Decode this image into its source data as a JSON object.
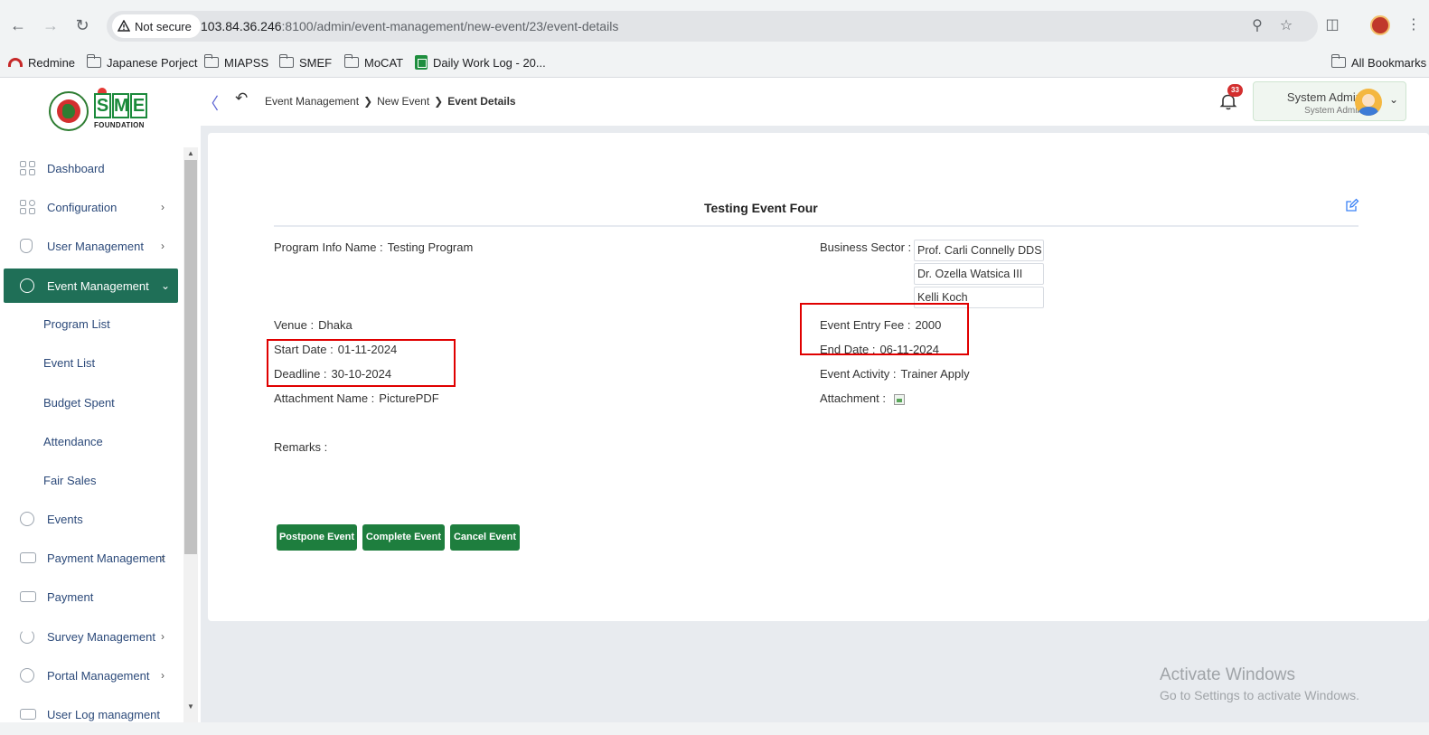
{
  "browser": {
    "security_label": "Not secure",
    "url_host": "103.84.36.246",
    "url_path": ":8100/admin/event-management/new-event/23/event-details",
    "bookmarks": [
      {
        "label": "Redmine",
        "icon": "redmine-icon"
      },
      {
        "label": "Japanese Porject",
        "icon": "folder-icon"
      },
      {
        "label": "MIAPSS",
        "icon": "folder-icon"
      },
      {
        "label": "SMEF",
        "icon": "folder-icon"
      },
      {
        "label": "MoCAT",
        "icon": "folder-icon"
      },
      {
        "label": "Daily Work Log - 20...",
        "icon": "sheets-icon"
      }
    ],
    "all_bookmarks": "All Bookmarks"
  },
  "header": {
    "logo_text": "SME",
    "logo_sub": "FOUNDATION",
    "breadcrumb": [
      "Event Management",
      "New Event",
      "Event Details"
    ],
    "notification_count": "33",
    "user_name": "System Admin",
    "user_role": "System Admin"
  },
  "sidebar": {
    "items": [
      {
        "label": "Dashboard",
        "icon": "dashboard-icon"
      },
      {
        "label": "Configuration",
        "icon": "configuration-icon"
      },
      {
        "label": "User Management",
        "icon": "user-management-icon"
      },
      {
        "label": "Event Management",
        "icon": "event-management-icon"
      },
      {
        "label": "Events",
        "icon": "events-icon"
      },
      {
        "label": "Payment Management",
        "icon": "payment-management-icon"
      },
      {
        "label": "Payment",
        "icon": "payment-icon"
      },
      {
        "label": "Survey Management",
        "icon": "survey-icon"
      },
      {
        "label": "Portal Management",
        "icon": "portal-icon"
      },
      {
        "label": "User Log managment",
        "icon": "log-icon"
      }
    ],
    "sub_items": [
      "Program List",
      "Event List",
      "Budget Spent",
      "Attendance",
      "Fair Sales"
    ]
  },
  "event": {
    "title": "Testing Event Four",
    "program_info_label": "Program Info Name :",
    "program_info_value": "Testing Program",
    "business_sector_label": "Business Sector :",
    "business_sectors": [
      "Prof. Carli Connelly DDS",
      "Dr. Ozella Watsica III",
      "Kelli Koch"
    ],
    "venue_label": "Venue :",
    "venue_value": "Dhaka",
    "entry_fee_label": "Event Entry Fee :",
    "entry_fee_value": "2000",
    "start_date_label": "Start Date :",
    "start_date_value": "01-11-2024",
    "end_date_label": "End Date :",
    "end_date_value": "06-11-2024",
    "deadline_label": "Deadline :",
    "deadline_value": "30-10-2024",
    "activity_label": "Event Activity :",
    "activity_value": "Trainer Apply",
    "attachment_name_label": "Attachment Name :",
    "attachment_name_value": "PicturePDF",
    "attachment_label": "Attachment :",
    "remarks_label": "Remarks :",
    "remarks_value": ""
  },
  "actions": {
    "postpone": "Postpone Event",
    "complete": "Complete Event",
    "cancel": "Cancel Event"
  },
  "watermark": {
    "title": "Activate Windows",
    "subtitle": "Go to Settings to activate Windows."
  },
  "colors": {
    "primary_green": "#1e7e3e",
    "sidebar_active": "#1f6f57",
    "highlight_red": "#e00000"
  }
}
